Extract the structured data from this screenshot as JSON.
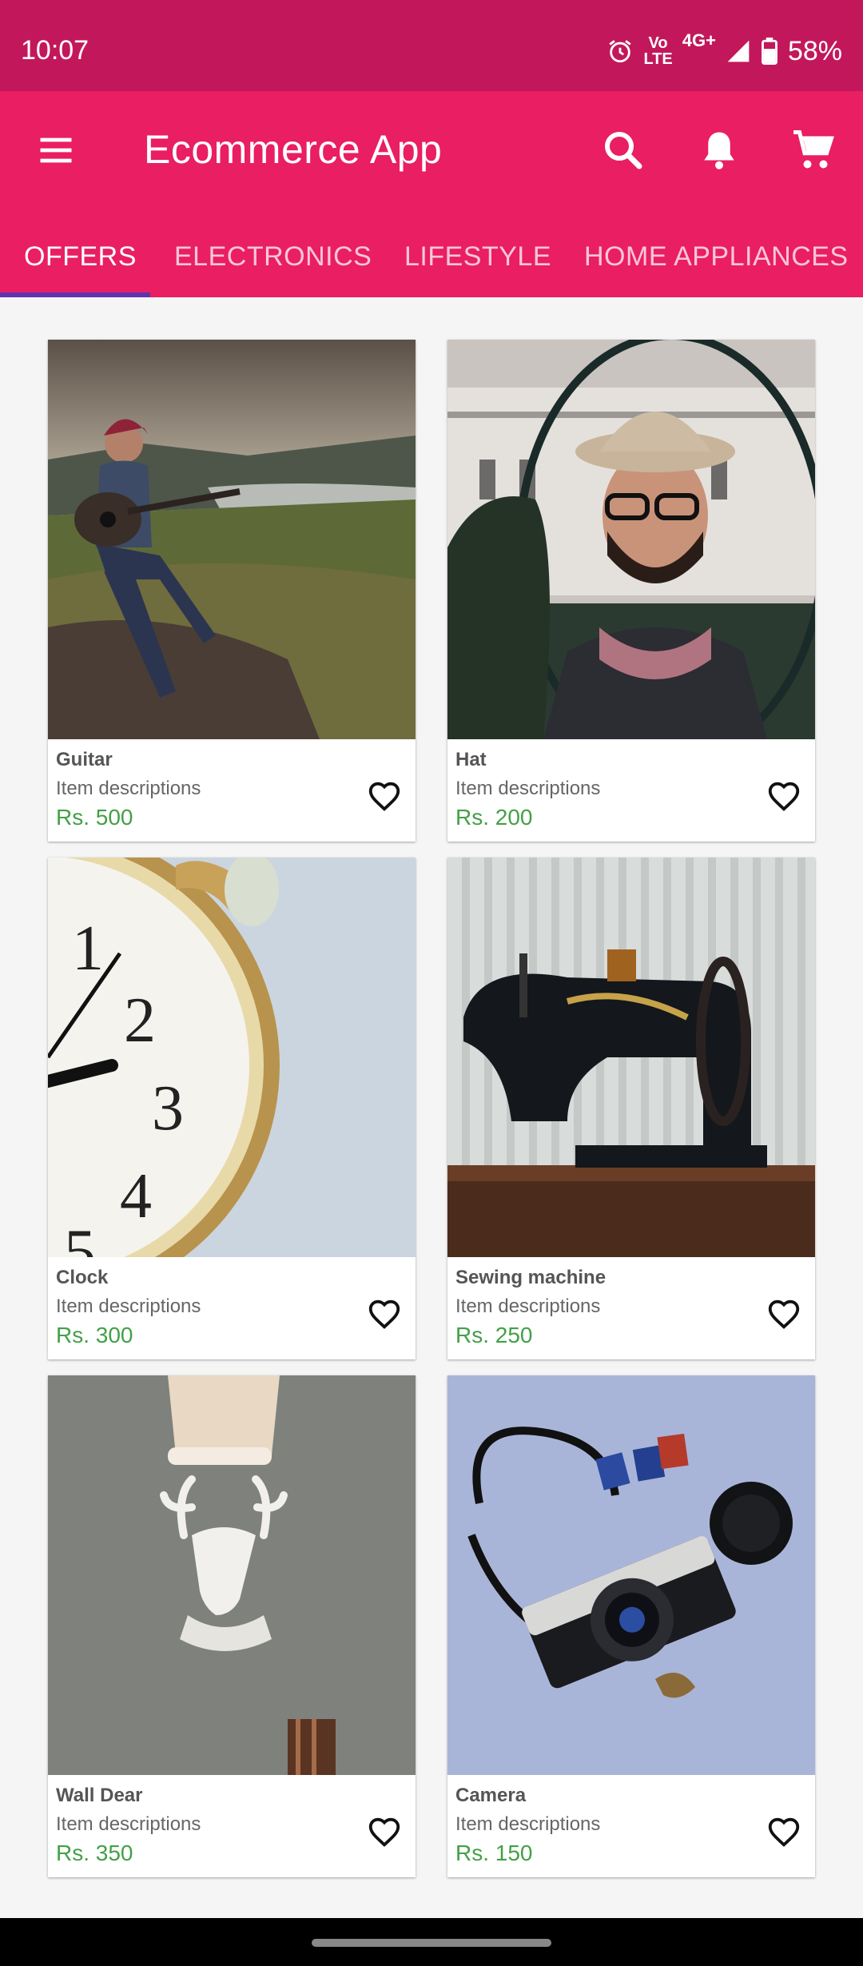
{
  "status_bar": {
    "time": "10:07",
    "volte_line1": "Vo",
    "volte_line2": "LTE",
    "network": "4G+",
    "battery": "58%"
  },
  "app_bar": {
    "title": "Ecommerce App",
    "icons": [
      "menu-icon",
      "search-icon",
      "bell-icon",
      "cart-icon"
    ]
  },
  "tabs": [
    {
      "label": "OFFERS",
      "active": true
    },
    {
      "label": "ELECTRONICS",
      "active": false
    },
    {
      "label": "LIFESTYLE",
      "active": false
    },
    {
      "label": "HOME APPLIANCES",
      "active": false
    }
  ],
  "products": [
    {
      "name": "Guitar",
      "description": "Item descriptions",
      "price": "Rs. 500"
    },
    {
      "name": "Hat",
      "description": "Item descriptions",
      "price": "Rs. 200"
    },
    {
      "name": "Clock",
      "description": "Item descriptions",
      "price": "Rs. 300"
    },
    {
      "name": "Sewing machine",
      "description": "Item descriptions",
      "price": "Rs. 250"
    },
    {
      "name": "Wall Dear",
      "description": "Item descriptions",
      "price": "Rs. 350"
    },
    {
      "name": "Camera",
      "description": "Item descriptions",
      "price": "Rs. 150"
    }
  ],
  "colors": {
    "status_bar": "#c2185b",
    "app_bar": "#e91e63",
    "tab_indicator": "#5e35b1",
    "price": "#43a047"
  }
}
